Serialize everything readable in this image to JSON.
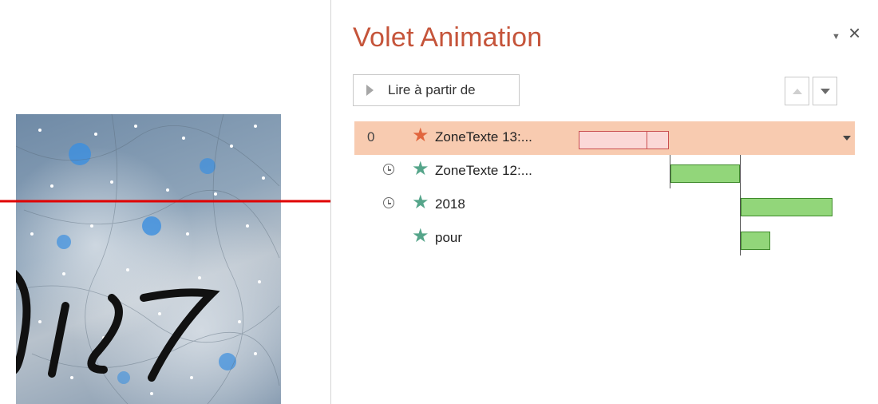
{
  "pane": {
    "title": "Volet Animation",
    "play_label": "Lire à partir de",
    "dropdown_icon": "chevron-down-icon",
    "close_icon": "close-icon"
  },
  "animations": [
    {
      "order": "0",
      "label": "ZoneTexte 13:...",
      "trigger": "on-click",
      "effect_color": "#e1653d",
      "selected": true
    },
    {
      "order": "",
      "label": "ZoneTexte 12:...",
      "trigger": "after-previous",
      "effect_color": "#55a58a",
      "selected": false
    },
    {
      "order": "",
      "label": "2018",
      "trigger": "after-previous",
      "effect_color": "#55a58a",
      "selected": false
    },
    {
      "order": "",
      "label": "pour",
      "trigger": "with-previous",
      "effect_color": "#55a58a",
      "selected": false
    }
  ],
  "colors": {
    "title": "#c5543a",
    "selected_row": "#f8cbb0",
    "bar_green": "#92d67a",
    "bar_pink": "#fbd8d7",
    "arrow": "#e00000"
  }
}
